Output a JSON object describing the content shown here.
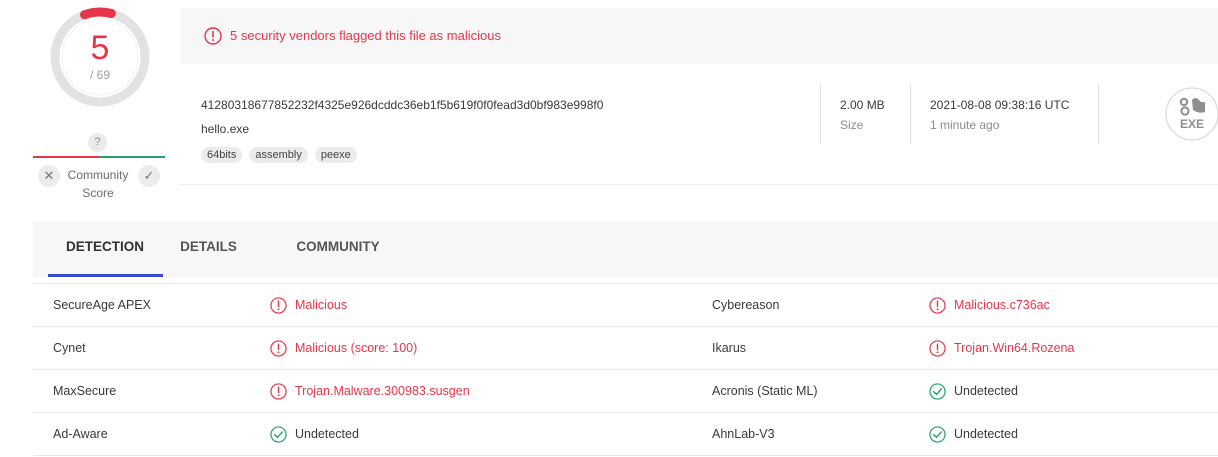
{
  "score": {
    "positives": "5",
    "total": "/ 69",
    "fraction_flagged": 0.0725,
    "color": "#e9354a"
  },
  "community": {
    "question_mark": "?",
    "label_line1": "Community",
    "label_line2": "Score",
    "downvote_icon": "close-icon",
    "upvote_icon": "check-icon"
  },
  "alert": {
    "icon": "alert-circle-icon",
    "text": "5 security vendors flagged this file as malicious"
  },
  "file": {
    "hash": "41280318677852232f4325e926dcddc36eb1f5b619f0f0fead3d0bf983e998f0",
    "name": "hello.exe",
    "tags": [
      "64bits",
      "assembly",
      "peexe"
    ],
    "size_value": "2.00 MB",
    "size_label": "Size",
    "date_value": "2021-08-08 09:38:16 UTC",
    "date_ago": "1 minute ago",
    "type_icon_label": "EXE"
  },
  "tabs": [
    {
      "label": "DETECTION",
      "active": true
    },
    {
      "label": "DETAILS",
      "active": false
    },
    {
      "label": "COMMUNITY",
      "active": false
    }
  ],
  "detections": [
    {
      "left": {
        "engine": "SecureAge APEX",
        "result": "Malicious",
        "status": "malicious"
      },
      "right": {
        "engine": "Cybereason",
        "result": "Malicious.c736ac",
        "status": "malicious"
      }
    },
    {
      "left": {
        "engine": "Cynet",
        "result": "Malicious (score: 100)",
        "status": "malicious"
      },
      "right": {
        "engine": "Ikarus",
        "result": "Trojan.Win64.Rozena",
        "status": "malicious"
      }
    },
    {
      "left": {
        "engine": "MaxSecure",
        "result": "Trojan.Malware.300983.susgen",
        "status": "malicious"
      },
      "right": {
        "engine": "Acronis (Static ML)",
        "result": "Undetected",
        "status": "undetected"
      }
    },
    {
      "left": {
        "engine": "Ad-Aware",
        "result": "Undetected",
        "status": "undetected"
      },
      "right": {
        "engine": "AhnLab-V3",
        "result": "Undetected",
        "status": "undetected"
      }
    }
  ],
  "colors": {
    "malicious": "#e9354a",
    "undetected": "#26a269",
    "tab_active": "#3b4cd0"
  }
}
